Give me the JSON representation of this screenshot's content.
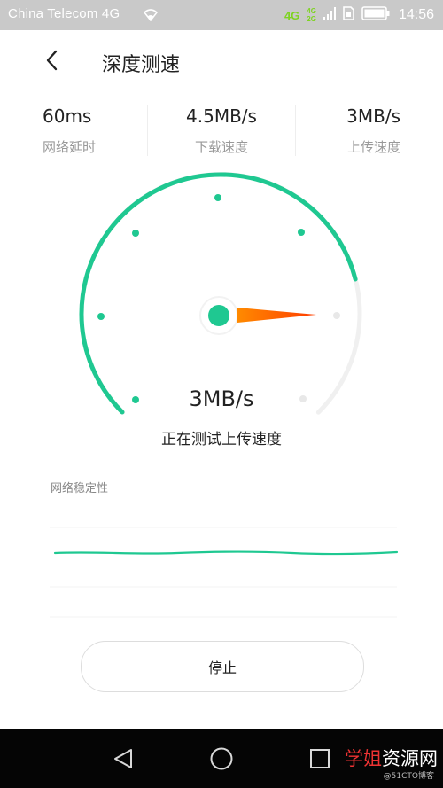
{
  "status_bar": {
    "carrier": "China Telecom 4G",
    "network_primary": "4G",
    "network_secondary_top": "4G",
    "network_secondary_bottom": "2G",
    "time": "14:56",
    "icons": [
      "wifi-icon",
      "signal-icon",
      "sim-icon",
      "battery-icon"
    ]
  },
  "header": {
    "back_icon": "chevron-left-icon",
    "title": "深度测速"
  },
  "stats": [
    {
      "value": "60ms",
      "label": "网络延时"
    },
    {
      "value": "4.5MB/s",
      "label": "下载速度"
    },
    {
      "value": "3MB/s",
      "label": "上传速度"
    }
  ],
  "gauge": {
    "current_speed": "3MB/s",
    "status": "正在测试上传速度",
    "progress_fraction": 0.78,
    "accent_color": "#1fc891",
    "needle_color": "#ff6a00"
  },
  "stability": {
    "label": "网络稳定性"
  },
  "actions": {
    "stop_label": "停止"
  },
  "nav_bar": {
    "icons": [
      "back-triangle-icon",
      "home-circle-icon",
      "recents-square-icon"
    ]
  },
  "watermark": {
    "main_red": "学姐",
    "main_white": "资源网",
    "sub": "@51CTO博客"
  }
}
